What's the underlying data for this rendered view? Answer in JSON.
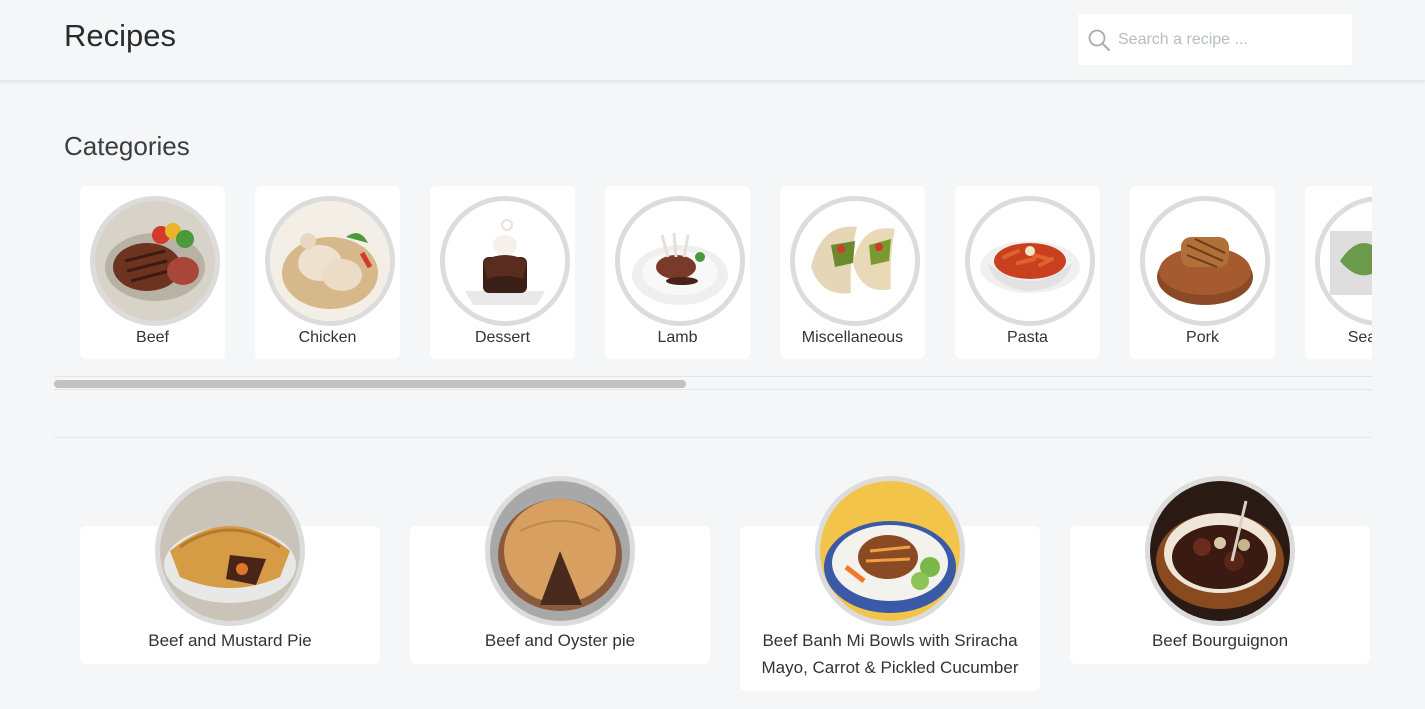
{
  "header": {
    "title": "Recipes",
    "search_placeholder": "Search a recipe ..."
  },
  "categories_section": {
    "title": "Categories",
    "items": [
      {
        "label": "Beef",
        "icon": "beef-photo"
      },
      {
        "label": "Chicken",
        "icon": "chicken-photo"
      },
      {
        "label": "Dessert",
        "icon": "dessert-photo"
      },
      {
        "label": "Lamb",
        "icon": "lamb-photo"
      },
      {
        "label": "Miscellaneous",
        "icon": "tacos-photo"
      },
      {
        "label": "Pasta",
        "icon": "pasta-photo"
      },
      {
        "label": "Pork",
        "icon": "pork-photo"
      },
      {
        "label": "Seafood",
        "icon": "seafood-photo"
      }
    ],
    "scroll_fraction": 0.48
  },
  "meals": [
    {
      "label": "Beef and Mustard Pie",
      "icon": "pie-photo"
    },
    {
      "label": "Beef and Oyster pie",
      "icon": "pie-slice-photo"
    },
    {
      "label": "Beef Banh Mi Bowls with Sriracha Mayo, Carrot & Pickled Cucumber",
      "icon": "rice-bowl-photo"
    },
    {
      "label": "Beef Bourguignon",
      "icon": "stew-photo"
    }
  ]
}
